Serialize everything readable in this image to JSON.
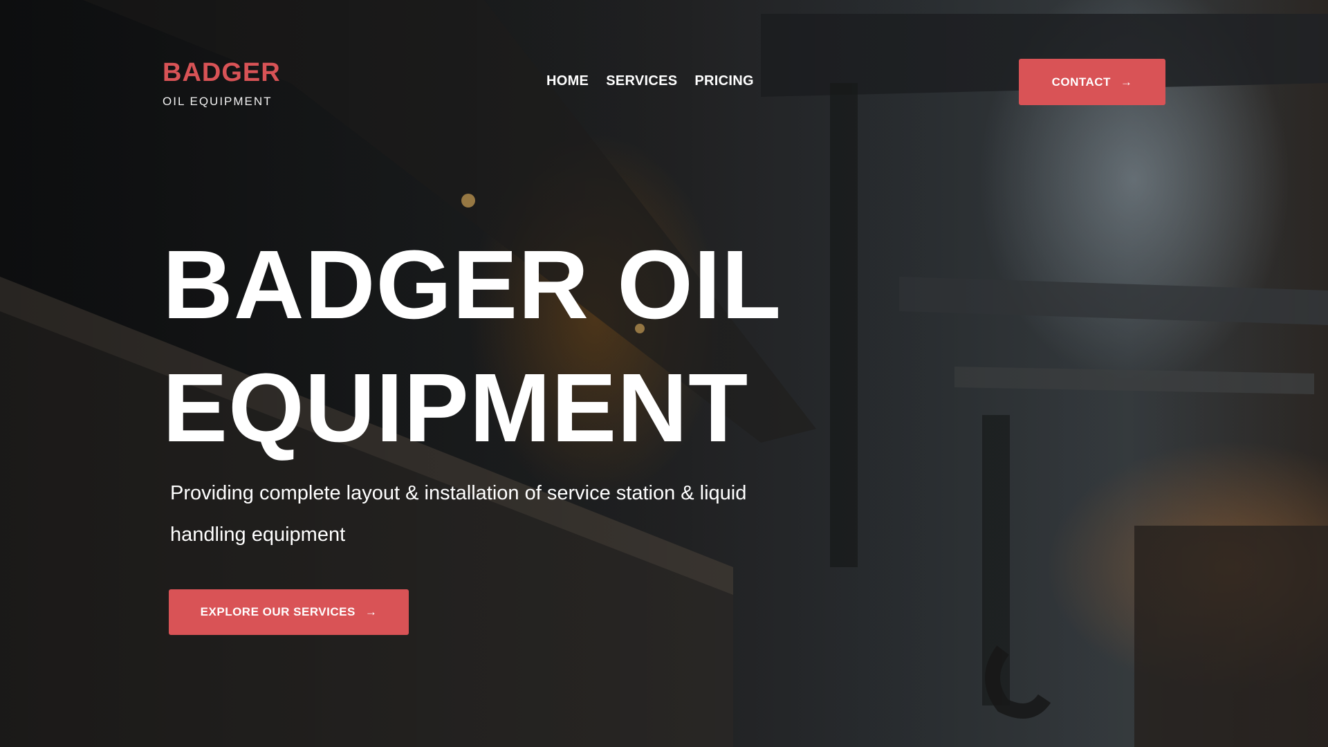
{
  "brand": {
    "name": "BADGER",
    "tagline": "OIL EQUIPMENT",
    "accent_color": "#d95356"
  },
  "nav": {
    "items": [
      {
        "label": "HOME"
      },
      {
        "label": "SERVICES"
      },
      {
        "label": "PRICING"
      }
    ]
  },
  "header": {
    "contact_label": "CONTACT",
    "contact_icon": "arrow-right-icon"
  },
  "hero": {
    "title": "BADGER OIL EQUIPMENT",
    "subtitle": "Providing complete layout & installation of service station & liquid handling equipment",
    "cta_label": "EXPLORE OUR SERVICES",
    "cta_icon": "arrow-right-icon"
  }
}
